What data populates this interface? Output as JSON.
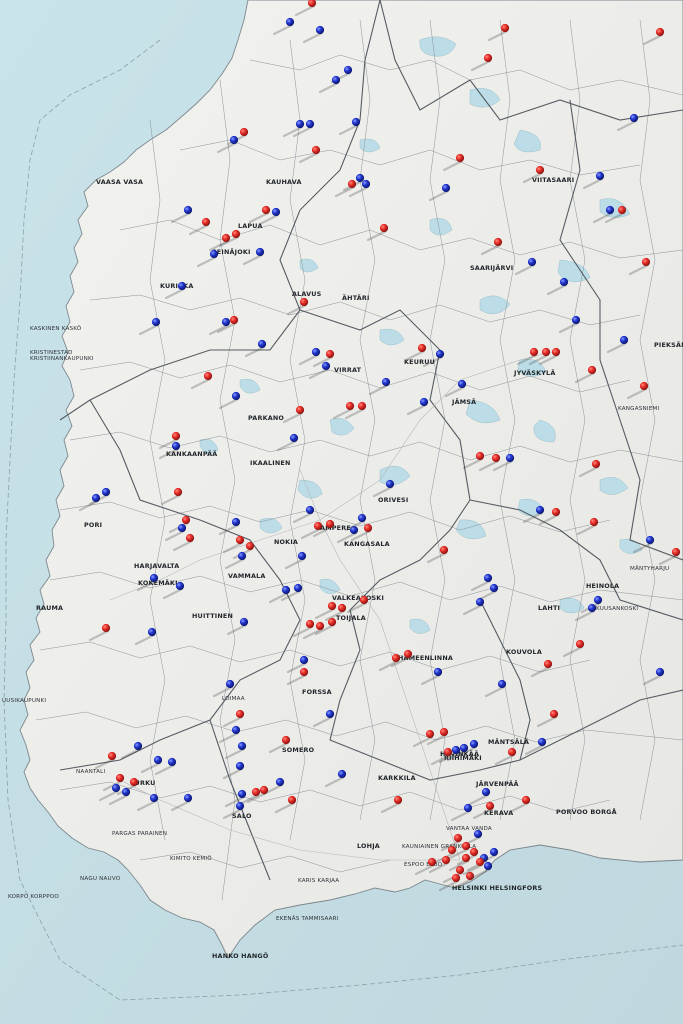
{
  "image": {
    "subject": "wall map of southern Finland with push pins",
    "colors": {
      "sea": "#c6e2ea",
      "land": "#f1f1ee",
      "border": "#6f7479",
      "lake": "#b9dbe6",
      "pin_red": "#e02a26",
      "pin_blue": "#1f35c4"
    }
  },
  "map_labels": [
    {
      "id": "vaasa",
      "text": "VAASA VASA"
    },
    {
      "id": "kaskinen",
      "text": "KASKINEN KASKÖ"
    },
    {
      "id": "kristiinankaupunki",
      "text": "KRISTIINANKAUPUNKI"
    },
    {
      "id": "pori",
      "text": "PORI"
    },
    {
      "id": "rauma",
      "text": "RAUMA"
    },
    {
      "id": "uusikaupunki",
      "text": "UUSIKAUPUNKI"
    },
    {
      "id": "naantali",
      "text": "NAANTALI"
    },
    {
      "id": "turku",
      "text": "TURKU"
    },
    {
      "id": "salo",
      "text": "SALO"
    },
    {
      "id": "parainen",
      "text": "PARGAS PARAINEN"
    },
    {
      "id": "hanko",
      "text": "HANKO HANGÖ"
    },
    {
      "id": "tammisaari",
      "text": "EKENÄS TAMMISAARI"
    },
    {
      "id": "karis",
      "text": "KARIS KARJAA"
    },
    {
      "id": "lohja",
      "text": "LOHJA"
    },
    {
      "id": "espoo",
      "text": "ESPOO ESBO"
    },
    {
      "id": "helsinki",
      "text": "HELSINKI HELSINGFORS"
    },
    {
      "id": "vantaa",
      "text": "VANTAA VANDA"
    },
    {
      "id": "kauniainen",
      "text": "KAUNIAINEN GRANKULLA"
    },
    {
      "id": "kerava",
      "text": "KERAVA"
    },
    {
      "id": "porvoo",
      "text": "PORVOO BORGÅ"
    },
    {
      "id": "hyvinkaa",
      "text": "HYVINKÄÄ"
    },
    {
      "id": "hameenlinna",
      "text": "HÄMEENLINNA"
    },
    {
      "id": "forssa",
      "text": "FORSSA"
    },
    {
      "id": "tampere",
      "text": "TAMPERE"
    },
    {
      "id": "nokia",
      "text": "NOKIA"
    },
    {
      "id": "ikaalinen",
      "text": "IKAALINEN"
    },
    {
      "id": "parkano",
      "text": "PARKANO"
    },
    {
      "id": "virrat",
      "text": "VIRRAT"
    },
    {
      "id": "alavus",
      "text": "ALAVUS"
    },
    {
      "id": "ahtari",
      "text": "ÄHTÄRI"
    },
    {
      "id": "keuruu",
      "text": "KEURUU"
    },
    {
      "id": "jyvaskyla",
      "text": "JYVÄSKYLÄ"
    },
    {
      "id": "jamsa",
      "text": "JÄMSÄ"
    },
    {
      "id": "orivesi",
      "text": "ORIVESI"
    },
    {
      "id": "lahti",
      "text": "LAHTI"
    },
    {
      "id": "kouvola",
      "text": "KOUVOLA"
    },
    {
      "id": "kuusankoski",
      "text": "KUUSANKOSKI"
    },
    {
      "id": "heinola",
      "text": "HEINOLA"
    },
    {
      "id": "vammala",
      "text": "VAMMALA"
    },
    {
      "id": "huittinen",
      "text": "HUITTINEN"
    },
    {
      "id": "kankaanpaa",
      "text": "KANKAANPÄÄ"
    },
    {
      "id": "kauhava",
      "text": "KAUHAVA"
    },
    {
      "id": "lapua",
      "text": "LAPUA"
    },
    {
      "id": "seinajoki",
      "text": "SEINÄJOKI"
    },
    {
      "id": "kurikka",
      "text": "KURIKKA"
    },
    {
      "id": "karkkila",
      "text": "KARKKILA"
    },
    {
      "id": "riihimaki",
      "text": "RIIHIMÄKI"
    },
    {
      "id": "valkeakoski",
      "text": "VALKEAKOSKI"
    },
    {
      "id": "toijala",
      "text": "TOIJALA"
    },
    {
      "id": "kangasala",
      "text": "KANGASALA"
    },
    {
      "id": "saarijarvi",
      "text": "SAARIJÄRVI"
    },
    {
      "id": "viitasaari",
      "text": "VIITASAARI"
    },
    {
      "id": "somero",
      "text": "SOMERO"
    },
    {
      "id": "loimaa",
      "text": "LOIMAA"
    },
    {
      "id": "mantsala",
      "text": "MÄNTSÄLÄ"
    },
    {
      "id": "jarvenpaa",
      "text": "JÄRVENPÄÄ"
    },
    {
      "id": "kemio",
      "text": "KIMITO KEMIÖ"
    },
    {
      "id": "nagu",
      "text": "NAGU NAUVO"
    },
    {
      "id": "korpo",
      "text": "KORPO KORPPOO"
    },
    {
      "id": "kokemaki",
      "text": "KOKEMÄKI"
    },
    {
      "id": "harjavalta",
      "text": "HARJAVALTA"
    },
    {
      "id": "kristinestad2",
      "text": "KRISTINESTAD"
    },
    {
      "id": "pieksamaki",
      "text": "PIEKSÄM"
    },
    {
      "id": "kangasniemi",
      "text": "KANGASNIEMI"
    },
    {
      "id": "mikkeli",
      "text": "MÄNTYHARJU"
    }
  ]
}
